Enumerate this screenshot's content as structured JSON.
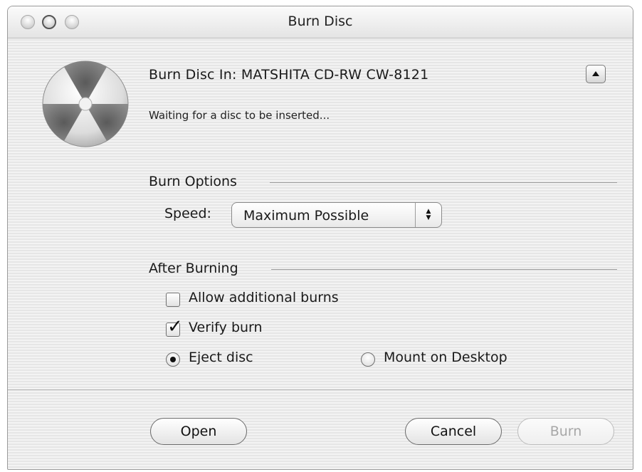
{
  "window": {
    "title": "Burn Disc"
  },
  "header": {
    "burn_disc_in": "Burn Disc In: MATSHITA CD-RW CW-8121",
    "status": "Waiting for a disc to be inserted..."
  },
  "burn_options": {
    "title": "Burn Options",
    "speed_label": "Speed:",
    "speed_value": "Maximum Possible"
  },
  "after_burning": {
    "title": "After Burning",
    "allow_additional_burns": {
      "label": "Allow additional burns",
      "checked": false
    },
    "verify_burn": {
      "label": "Verify burn",
      "checked": true
    },
    "eject_disc": {
      "label": "Eject disc",
      "selected": true
    },
    "mount_on_desktop": {
      "label": "Mount on Desktop",
      "selected": false
    }
  },
  "buttons": {
    "open": "Open",
    "cancel": "Cancel",
    "burn": "Burn"
  },
  "icons": {
    "close": "close-button-icon",
    "minimize": "minimize-button-icon",
    "zoom": "zoom-button-icon",
    "disc": "burn-disc-icon",
    "disclosure": "eject-triangle-icon",
    "checkmark": "checkmark-icon",
    "popup_arrows": "up-down-arrows-icon"
  }
}
